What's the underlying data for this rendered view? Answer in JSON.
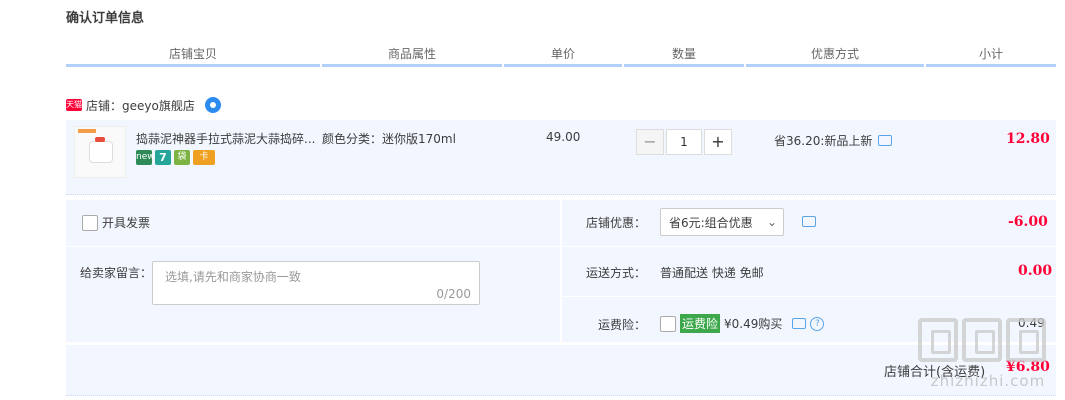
{
  "page_title": "确认订单信息",
  "headers": [
    "店铺宝贝",
    "商品属性",
    "单价",
    "数量",
    "优惠方式",
    "小计"
  ],
  "shop": {
    "badge": "天猫",
    "label": "店铺：geeyo旗舰店"
  },
  "item": {
    "title": "捣蒜泥神器手拉式蒜泥大蒜捣碎...",
    "attr": "颜色分类：迷你版170ml",
    "price": "49.00",
    "qty": "1",
    "qty_minus": "−",
    "qty_plus": "+",
    "promo": "省36.20:新品上新",
    "subtotal": "12.80",
    "service_icons": [
      "new-icon",
      "seven-day-return-icon",
      "shopping-bag-icon",
      "card-icon"
    ],
    "service_labels": [
      "new",
      "7",
      "袋",
      "卡"
    ]
  },
  "invoice_label": "开具发票",
  "message": {
    "label": "给卖家留言：",
    "placeholder": "选填,请先和商家协商一致",
    "count": "0/200"
  },
  "shop_discount": {
    "label": "店铺优惠：",
    "selected": "省6元:组合优惠",
    "value": "-6.00"
  },
  "shipping": {
    "label": "运送方式：",
    "text": "普通配送 快递 免邮",
    "value": "0.00"
  },
  "insurance": {
    "label": "运费险：",
    "badge": "运费险",
    "text": "¥0.49购买",
    "value": "0.49"
  },
  "total": {
    "label": "店铺合计(含运费)",
    "value": "¥6.80"
  },
  "watermark": {
    "text": "zhizhizhi.com"
  },
  "colors": {
    "accent_red": "#ff0036",
    "row_bg": "#f2f7ff",
    "header_border": "#b2d1ff",
    "insurance_green": "#3da84b"
  }
}
